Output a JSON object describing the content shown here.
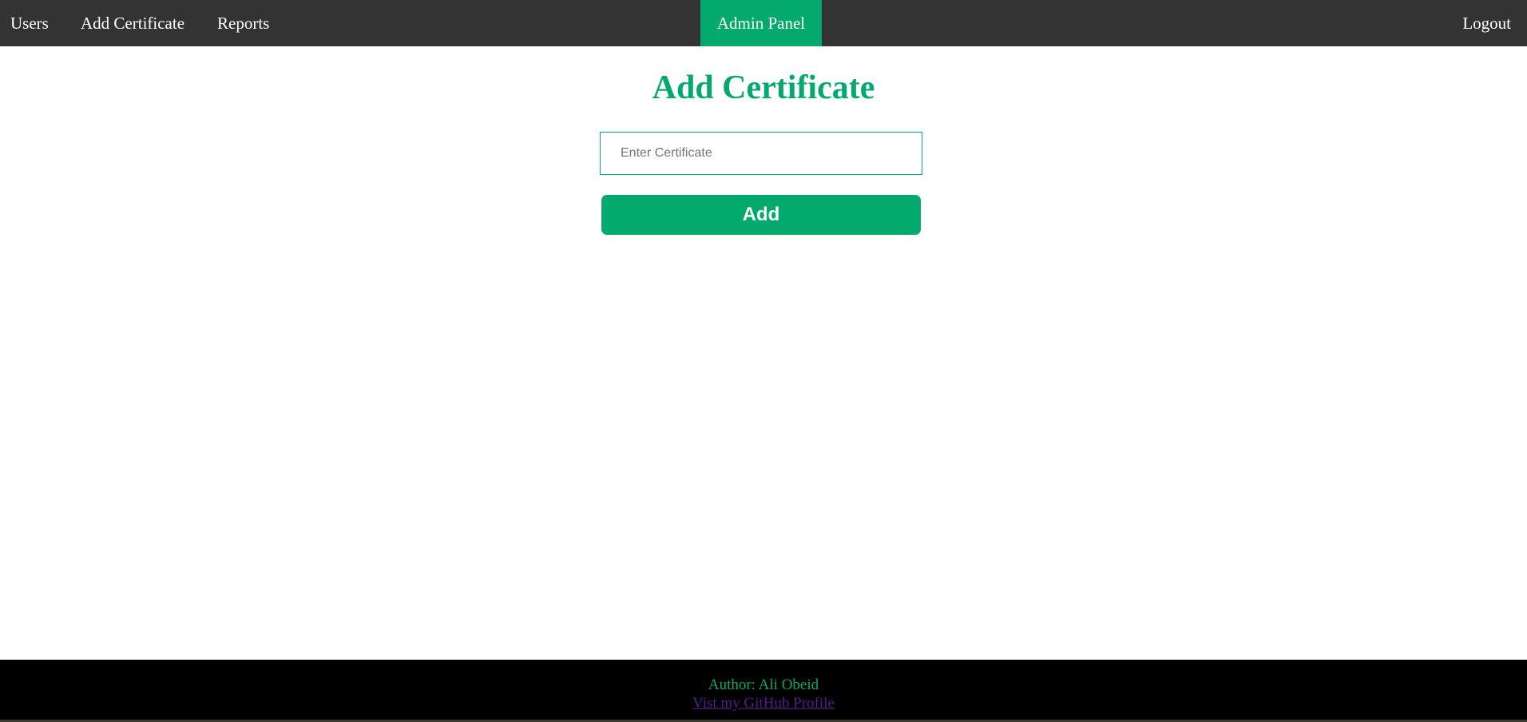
{
  "nav": {
    "users_label": "Users",
    "add_certificate_label": "Add Certificate",
    "reports_label": "Reports",
    "admin_panel_label": "Admin Panel",
    "logout_label": "Logout"
  },
  "main": {
    "title": "Add Certificate",
    "certificate_input": {
      "value": "",
      "placeholder": "Enter Certificate"
    },
    "add_button_label": "Add"
  },
  "footer": {
    "author": "Author: Ali Obeid",
    "github_link_label": "Vist my GitHub Profile"
  },
  "colors": {
    "accent": "#04aa6d",
    "nav_background": "#333333",
    "footer_background": "#000000",
    "visited_link": "#551a8b"
  }
}
